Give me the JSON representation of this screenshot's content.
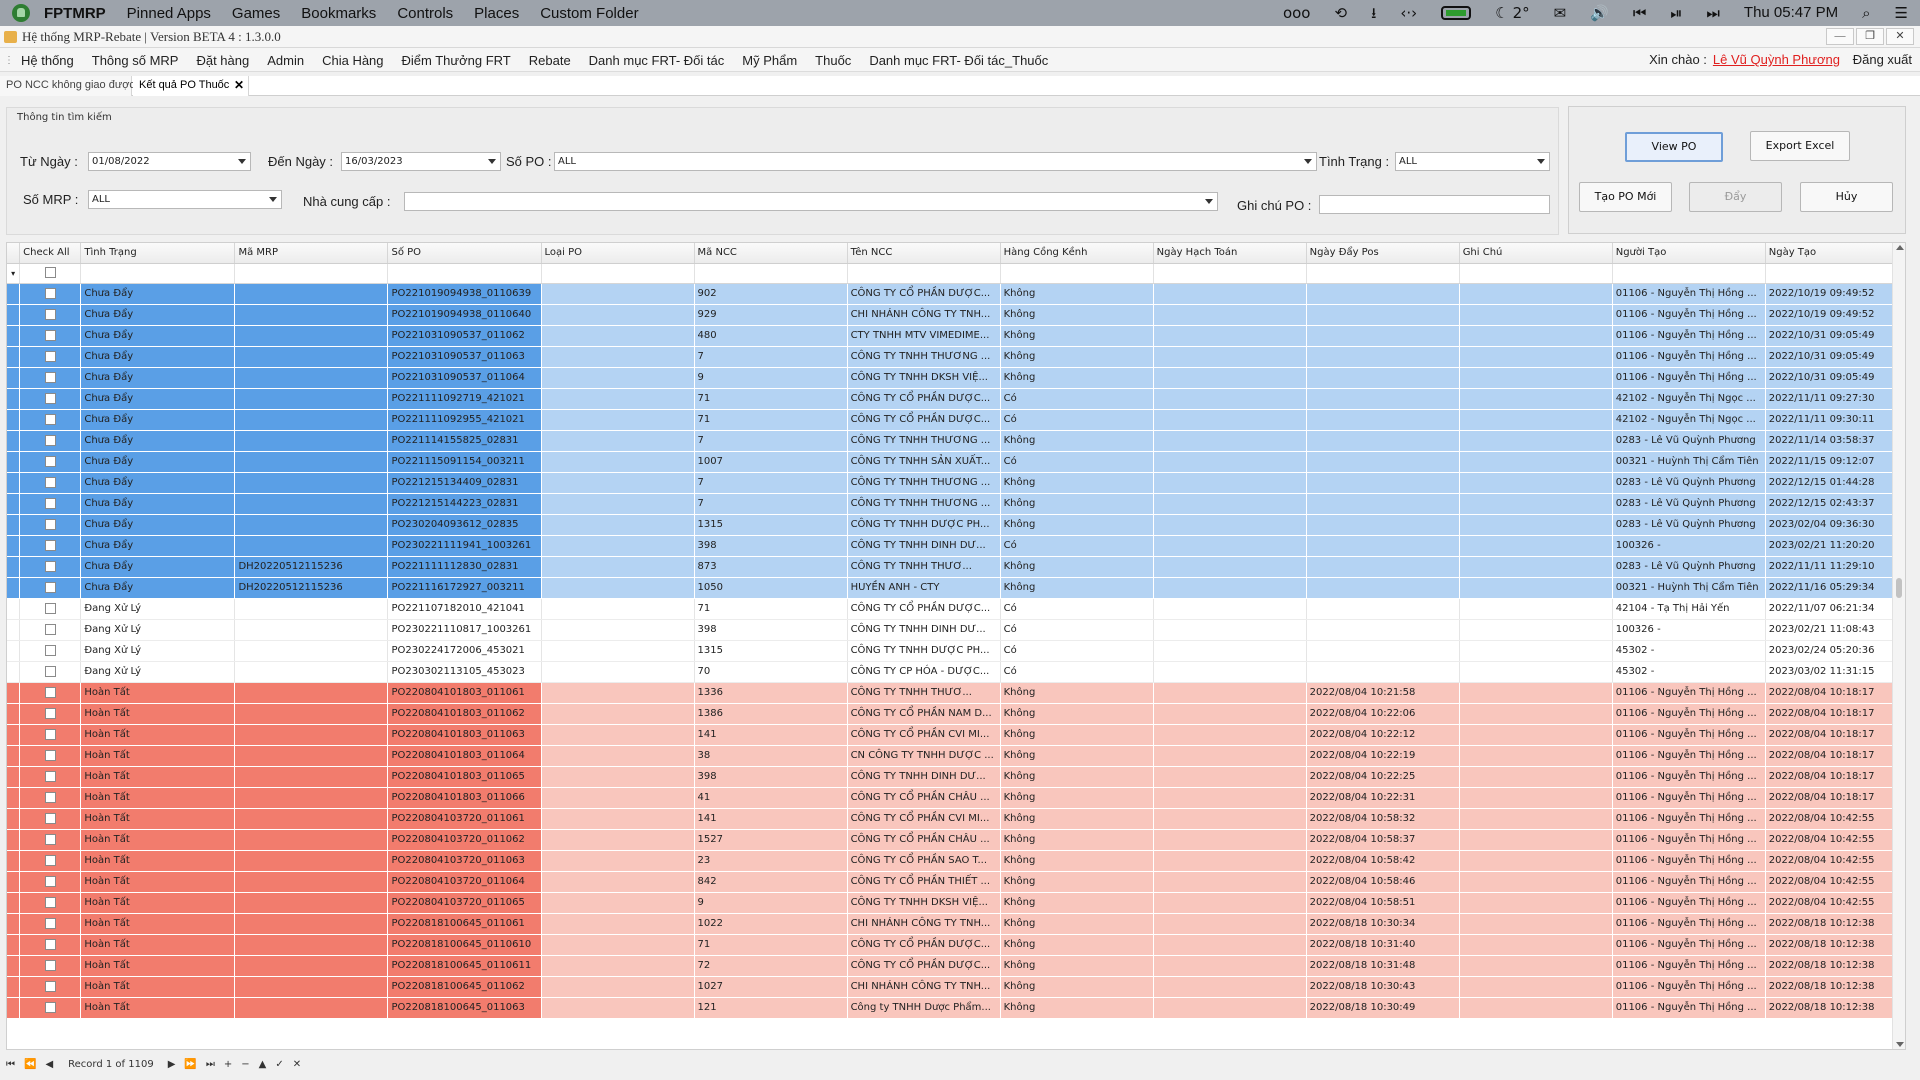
{
  "topbar": {
    "app": "FPTMRP",
    "menus": [
      "Pinned Apps",
      "Games",
      "Bookmarks",
      "Controls",
      "Places",
      "Custom Folder"
    ],
    "dots": "ooo",
    "weather": "2°",
    "clock": "Thu 05:47 PM"
  },
  "titlebar": {
    "title": "Hệ thống MRP-Rebate | Version BETA 4 : 1.3.0.0"
  },
  "menubar": {
    "items": [
      "Hệ thống",
      "Thông số MRP",
      "Đặt hàng",
      "Admin",
      "Chia Hàng",
      "Điểm Thưởng FRT",
      "Rebate",
      "Danh mục FRT- Đối tác",
      "Mỹ Phẩm",
      "Thuốc",
      "Danh mục FRT- Đối tác_Thuốc"
    ],
    "greeting": "Xin chào :",
    "user": "Lê Vũ Quỳnh Phương",
    "logout": "Đăng xuất"
  },
  "tabs": [
    {
      "label": "PO NCC không giao được"
    },
    {
      "label": "Kết quả PO Thuốc",
      "close": "✕"
    }
  ],
  "search": {
    "panel_title": "Thông tin tìm kiếm",
    "from_label": "Từ Ngày :",
    "from_value": "01/08/2022",
    "to_label": "Đến Ngày :",
    "to_value": "16/03/2023",
    "po_label": "Số PO :",
    "po_value": "ALL",
    "status_label": "Tình Trạng :",
    "status_value": "ALL",
    "mrp_label": "Số MRP :",
    "mrp_value": "ALL",
    "supplier_label": "Nhà cung cấp :",
    "supplier_value": "",
    "note_label": "Ghi chú PO :",
    "note_value": ""
  },
  "actions": {
    "view": "View PO",
    "export": "Export Excel",
    "create": "Tạo PO Mới",
    "push": "Đẩy",
    "cancel": "Hủy"
  },
  "grid": {
    "columns": [
      "Check All",
      "Tình Trạng",
      "Mã MRP",
      "Số PO",
      "Loại PO",
      "Mã NCC",
      "Tên NCC",
      "Hàng Cồng Kềnh",
      "Ngày Hạch Toán",
      "Ngày Đẩy Pos",
      "Ghi Chú",
      "Người Tạo",
      "Ngày Tạo"
    ],
    "filter_mark": "▾",
    "rows": [
      [
        "Chưa Đẩy",
        "",
        "PO221019094938_0110639",
        "",
        "902",
        "CÔNG TY CỔ PHẦN DƯỢC...",
        "Không",
        "",
        "",
        "",
        "01106 - Nguyễn Thị Hồng ...",
        "2022/10/19 09:49:52"
      ],
      [
        "Chưa Đẩy",
        "",
        "PO221019094938_0110640",
        "",
        "929",
        "CHI NHÁNH CÔNG TY TNH...",
        "Không",
        "",
        "",
        "",
        "01106 - Nguyễn Thị Hồng ...",
        "2022/10/19 09:49:52"
      ],
      [
        "Chưa Đẩy",
        "",
        "PO221031090537_011062",
        "",
        "480",
        "CTY TNHH MTV VIMEDIME...",
        "Không",
        "",
        "",
        "",
        "01106 - Nguyễn Thị Hồng ...",
        "2022/10/31 09:05:49"
      ],
      [
        "Chưa Đẩy",
        "",
        "PO221031090537_011063",
        "",
        "7",
        "CÔNG TY TNHH THƯƠNG ...",
        "Không",
        "",
        "",
        "",
        "01106 - Nguyễn Thị Hồng ...",
        "2022/10/31 09:05:49"
      ],
      [
        "Chưa Đẩy",
        "",
        "PO221031090537_011064",
        "",
        "9",
        "CÔNG TY TNHH DKSH VIỆ...",
        "Không",
        "",
        "",
        "",
        "01106 - Nguyễn Thị Hồng ...",
        "2022/10/31 09:05:49"
      ],
      [
        "Chưa Đẩy",
        "",
        "PO221111092719_421021",
        "",
        "71",
        "CÔNG TY CỔ PHẦN DƯỢC...",
        "Có",
        "",
        "",
        "",
        "42102 - Nguyễn Thị Ngọc ...",
        "2022/11/11 09:27:30"
      ],
      [
        "Chưa Đẩy",
        "",
        "PO221111092955_421021",
        "",
        "71",
        "CÔNG TY CỔ PHẦN DƯỢC...",
        "Có",
        "",
        "",
        "",
        "42102 - Nguyễn Thị Ngọc ...",
        "2022/11/11 09:30:11"
      ],
      [
        "Chưa Đẩy",
        "",
        "PO221114155825_02831",
        "",
        "7",
        "CÔNG TY TNHH THƯƠNG ...",
        "Không",
        "",
        "",
        "",
        "0283 - Lê Vũ Quỳnh Phương",
        "2022/11/14 03:58:37"
      ],
      [
        "Chưa Đẩy",
        "",
        "PO221115091154_003211",
        "",
        "1007",
        "CÔNG TY TNHH SẢN XUẤT...",
        "Có",
        "",
        "",
        "",
        "00321 - Huỳnh Thị Cẩm Tiên",
        "2022/11/15 09:12:07"
      ],
      [
        "Chưa Đẩy",
        "",
        "PO221215134409_02831",
        "",
        "7",
        "CÔNG TY TNHH THƯƠNG ...",
        "Không",
        "",
        "",
        "",
        "0283 - Lê Vũ Quỳnh Phương",
        "2022/12/15 01:44:28"
      ],
      [
        "Chưa Đẩy",
        "",
        "PO221215144223_02831",
        "",
        "7",
        "CÔNG TY TNHH THƯƠNG ...",
        "Không",
        "",
        "",
        "",
        "0283 - Lê Vũ Quỳnh Phương",
        "2022/12/15 02:43:37"
      ],
      [
        "Chưa Đẩy",
        "",
        "PO230204093612_02835",
        "",
        "1315",
        "CÔNG TY TNHH DƯỢC PH...",
        "Không",
        "",
        "",
        "",
        "0283 - Lê Vũ Quỳnh Phương",
        "2023/02/04 09:36:30"
      ],
      [
        "Chưa Đẩy",
        "",
        "PO230221111941_1003261",
        "",
        "398",
        "CÔNG TY TNHH DINH DƯ...",
        "Có",
        "",
        "",
        "",
        "100326 -",
        "2023/02/21 11:20:20"
      ],
      [
        "Chưa Đẩy",
        "DH20220512115236",
        "PO221111112830_02831",
        "",
        "873",
        "CÔNG TY TNHH THƯƠ...",
        "Không",
        "",
        "",
        "",
        "0283 - Lê Vũ Quỳnh Phương",
        "2022/11/11 11:29:10"
      ],
      [
        "Chưa Đẩy",
        "DH20220512115236",
        "PO221116172927_003211",
        "",
        "1050",
        "HUYỀN ANH - CTY",
        "Không",
        "",
        "",
        "",
        "00321 - Huỳnh Thị Cẩm Tiên",
        "2022/11/16 05:29:34"
      ],
      [
        "Đang Xử Lý",
        "",
        "PO221107182010_421041",
        "",
        "71",
        "CÔNG TY CỔ PHẦN DƯỢC...",
        "Có",
        "",
        "",
        "",
        "42104 - Tạ Thị Hải Yến",
        "2022/11/07 06:21:34"
      ],
      [
        "Đang Xử Lý",
        "",
        "PO230221110817_1003261",
        "",
        "398",
        "CÔNG TY TNHH DINH DƯ...",
        "Có",
        "",
        "",
        "",
        "100326 -",
        "2023/02/21 11:08:43"
      ],
      [
        "Đang Xử Lý",
        "",
        "PO230224172006_453021",
        "",
        "1315",
        "CÔNG TY TNHH DƯỢC PH...",
        "Có",
        "",
        "",
        "",
        "45302 -",
        "2023/02/24 05:20:36"
      ],
      [
        "Đang Xử Lý",
        "",
        "PO230302113105_453023",
        "",
        "70",
        "CÔNG TY CP HÓA - DƯỢC...",
        "Có",
        "",
        "",
        "",
        "45302 -",
        "2023/03/02 11:31:15"
      ],
      [
        "Hoàn Tất",
        "",
        "PO220804101803_011061",
        "",
        "1336",
        "CÔNG TY TNHH THƯƠ...",
        "Không",
        "",
        "2022/08/04 10:21:58",
        "",
        "01106 - Nguyễn Thị Hồng ...",
        "2022/08/04 10:18:17"
      ],
      [
        "Hoàn Tất",
        "",
        "PO220804101803_011062",
        "",
        "1386",
        "CÔNG TY CỔ PHẦN NAM D...",
        "Không",
        "",
        "2022/08/04 10:22:06",
        "",
        "01106 - Nguyễn Thị Hồng ...",
        "2022/08/04 10:18:17"
      ],
      [
        "Hoàn Tất",
        "",
        "PO220804101803_011063",
        "",
        "141",
        "CÔNG TY CỔ PHẦN CVI MI...",
        "Không",
        "",
        "2022/08/04 10:22:12",
        "",
        "01106 - Nguyễn Thị Hồng ...",
        "2022/08/04 10:18:17"
      ],
      [
        "Hoàn Tất",
        "",
        "PO220804101803_011064",
        "",
        "38",
        "CN CÔNG TY TNHH DƯỢC ...",
        "Không",
        "",
        "2022/08/04 10:22:19",
        "",
        "01106 - Nguyễn Thị Hồng ...",
        "2022/08/04 10:18:17"
      ],
      [
        "Hoàn Tất",
        "",
        "PO220804101803_011065",
        "",
        "398",
        "CÔNG TY TNHH DINH DƯ...",
        "Không",
        "",
        "2022/08/04 10:22:25",
        "",
        "01106 - Nguyễn Thị Hồng ...",
        "2022/08/04 10:18:17"
      ],
      [
        "Hoàn Tất",
        "",
        "PO220804101803_011066",
        "",
        "41",
        "CÔNG TY CỔ PHẦN CHÂU ...",
        "Không",
        "",
        "2022/08/04 10:22:31",
        "",
        "01106 - Nguyễn Thị Hồng ...",
        "2022/08/04 10:18:17"
      ],
      [
        "Hoàn Tất",
        "",
        "PO220804103720_011061",
        "",
        "141",
        "CÔNG TY CỔ PHẦN CVI MI...",
        "Không",
        "",
        "2022/08/04 10:58:32",
        "",
        "01106 - Nguyễn Thị Hồng ...",
        "2022/08/04 10:42:55"
      ],
      [
        "Hoàn Tất",
        "",
        "PO220804103720_011062",
        "",
        "1527",
        "CÔNG TY CỔ PHẦN CHÂU ...",
        "Không",
        "",
        "2022/08/04 10:58:37",
        "",
        "01106 - Nguyễn Thị Hồng ...",
        "2022/08/04 10:42:55"
      ],
      [
        "Hoàn Tất",
        "",
        "PO220804103720_011063",
        "",
        "23",
        "CÔNG TY CỔ PHẦN SAO T...",
        "Không",
        "",
        "2022/08/04 10:58:42",
        "",
        "01106 - Nguyễn Thị Hồng ...",
        "2022/08/04 10:42:55"
      ],
      [
        "Hoàn Tất",
        "",
        "PO220804103720_011064",
        "",
        "842",
        "CÔNG TY CỔ PHẦN THIẾT ...",
        "Không",
        "",
        "2022/08/04 10:58:46",
        "",
        "01106 - Nguyễn Thị Hồng ...",
        "2022/08/04 10:42:55"
      ],
      [
        "Hoàn Tất",
        "",
        "PO220804103720_011065",
        "",
        "9",
        "CÔNG TY TNHH DKSH VIỆ...",
        "Không",
        "",
        "2022/08/04 10:58:51",
        "",
        "01106 - Nguyễn Thị Hồng ...",
        "2022/08/04 10:42:55"
      ],
      [
        "Hoàn Tất",
        "",
        "PO220818100645_011061",
        "",
        "1022",
        "CHI NHÁNH CÔNG TY TNH...",
        "Không",
        "",
        "2022/08/18 10:30:34",
        "",
        "01106 - Nguyễn Thị Hồng ...",
        "2022/08/18 10:12:38"
      ],
      [
        "Hoàn Tất",
        "",
        "PO220818100645_0110610",
        "",
        "71",
        "CÔNG TY CỔ PHẦN DƯỢC...",
        "Không",
        "",
        "2022/08/18 10:31:40",
        "",
        "01106 - Nguyễn Thị Hồng ...",
        "2022/08/18 10:12:38"
      ],
      [
        "Hoàn Tất",
        "",
        "PO220818100645_0110611",
        "",
        "72",
        "CÔNG TY CỔ PHẦN DƯỢC...",
        "Không",
        "",
        "2022/08/18 10:31:48",
        "",
        "01106 - Nguyễn Thị Hồng ...",
        "2022/08/18 10:12:38"
      ],
      [
        "Hoàn Tất",
        "",
        "PO220818100645_011062",
        "",
        "1027",
        "CHI NHÁNH CÔNG TY TNH...",
        "Không",
        "",
        "2022/08/18 10:30:43",
        "",
        "01106 - Nguyễn Thị Hồng ...",
        "2022/08/18 10:12:38"
      ],
      [
        "Hoàn Tất",
        "",
        "PO220818100645_011063",
        "",
        "121",
        "Công ty TNHH Dược Phẩm...",
        "Không",
        "",
        "2022/08/18 10:30:49",
        "",
        "01106 - Nguyễn Thị Hồng ...",
        "2022/08/18 10:12:38"
      ]
    ]
  },
  "navigator": {
    "first": "⏮",
    "prev_page": "⏪",
    "prev": "◀",
    "record": "Record 1 of 1109",
    "next": "▶",
    "next_page": "⏩",
    "last": "⏭",
    "add": "+",
    "remove": "−",
    "up": "▲",
    "save": "✓",
    "cancel": "✕"
  },
  "colors": {
    "pending": "#5a9fe6",
    "processing": "#ffffff",
    "done": "#f27c6d",
    "user_link": "#e0201f"
  }
}
